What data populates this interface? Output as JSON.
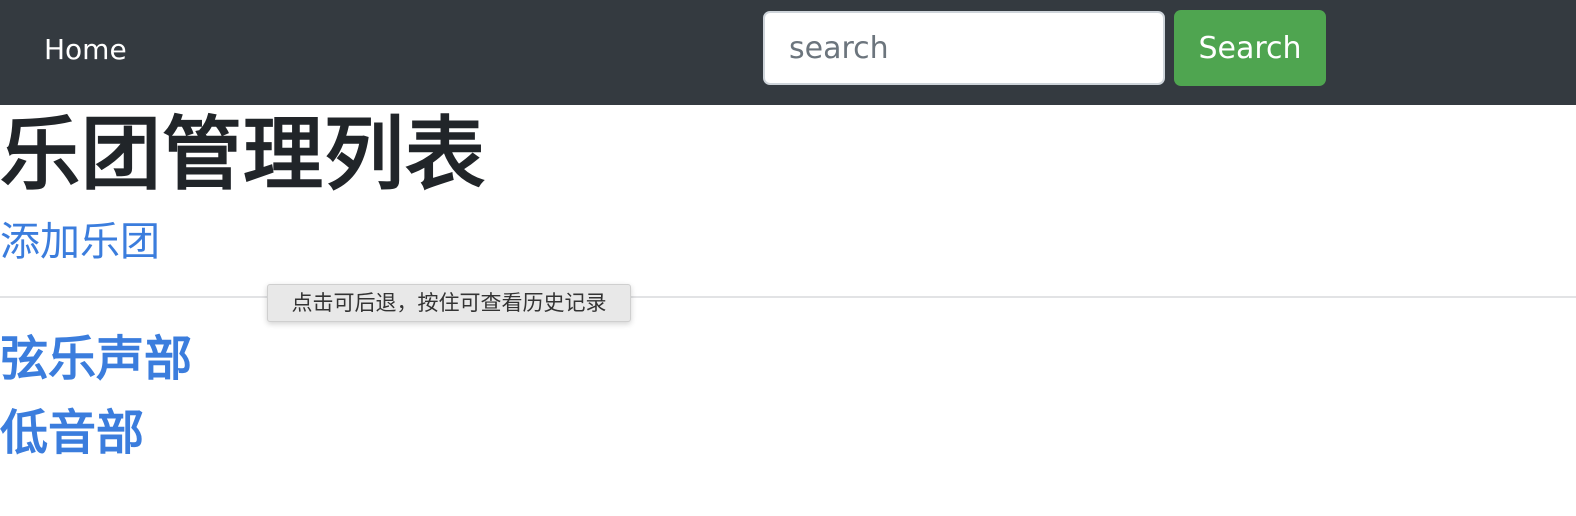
{
  "navbar": {
    "home_label": "Home",
    "search": {
      "placeholder": "search",
      "value": "",
      "button_label": "Search"
    }
  },
  "main": {
    "title": "乐团管理列表",
    "add_link": "添加乐团",
    "bands": [
      {
        "name": "弦乐声部"
      },
      {
        "name": "低音部"
      }
    ]
  },
  "tooltip": {
    "text": "点击可后退，按住可查看历史记录"
  },
  "colors": {
    "navbar_bg": "#343a40",
    "search_button_bg": "#4fa550",
    "link": "#3b7ddd",
    "title": "#212529"
  }
}
